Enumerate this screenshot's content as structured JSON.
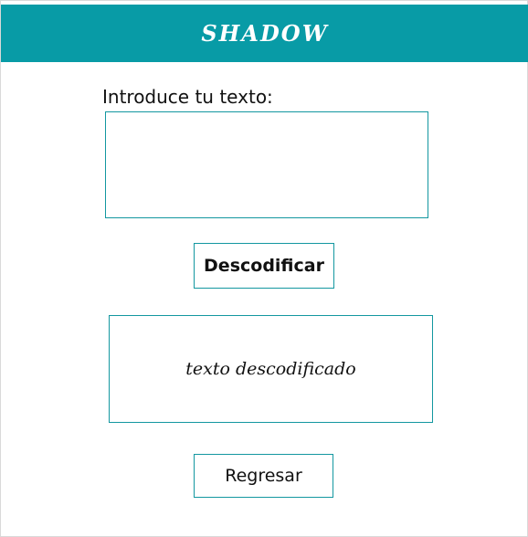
{
  "header": {
    "title": "SHADOW"
  },
  "main": {
    "prompt_label": "Introduce tu texto:",
    "input": {
      "value": "",
      "placeholder": ""
    },
    "decode_button_label": "Descodificar",
    "output_text": "texto descodificado",
    "back_button_label": "Regresar"
  },
  "colors": {
    "header_bg": "#089ba6",
    "accent_border": "#1397a0",
    "header_text": "#ffffff"
  }
}
